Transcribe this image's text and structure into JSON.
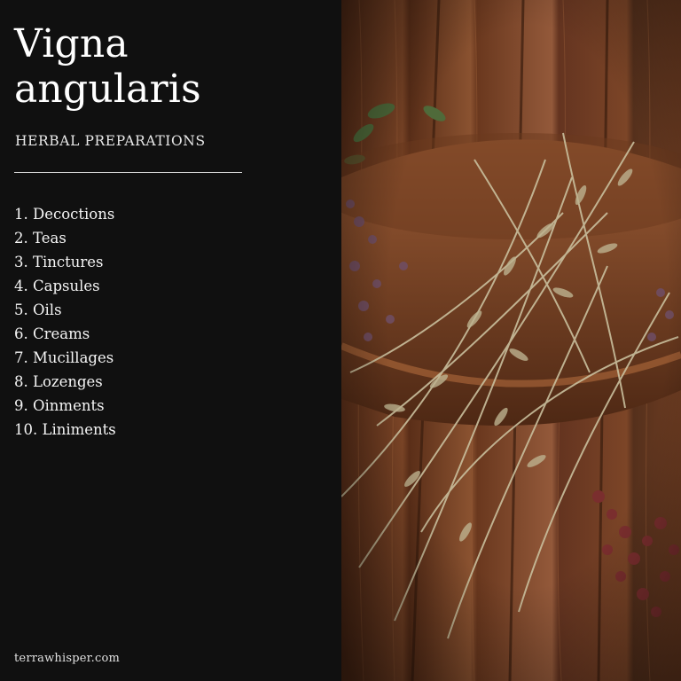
{
  "title_line1": "Vigna",
  "title_line2": "angularis",
  "subtitle": "HERBAL PREPARATIONS",
  "preparations": [
    "1. Decoctions",
    "2. Teas",
    "3. Tinctures",
    "4. Capsules",
    "5. Oils",
    "6. Creams",
    "7. Mucillages",
    "8. Lozenges",
    "9. Oinments",
    "10. Liniments"
  ],
  "website": "terrawhisper.com",
  "colors": {
    "panel": "#101010",
    "text": "#f3f3f3",
    "wood": "#7a4426",
    "herb": "#b8ad8a",
    "flower": "#6f4e66"
  }
}
